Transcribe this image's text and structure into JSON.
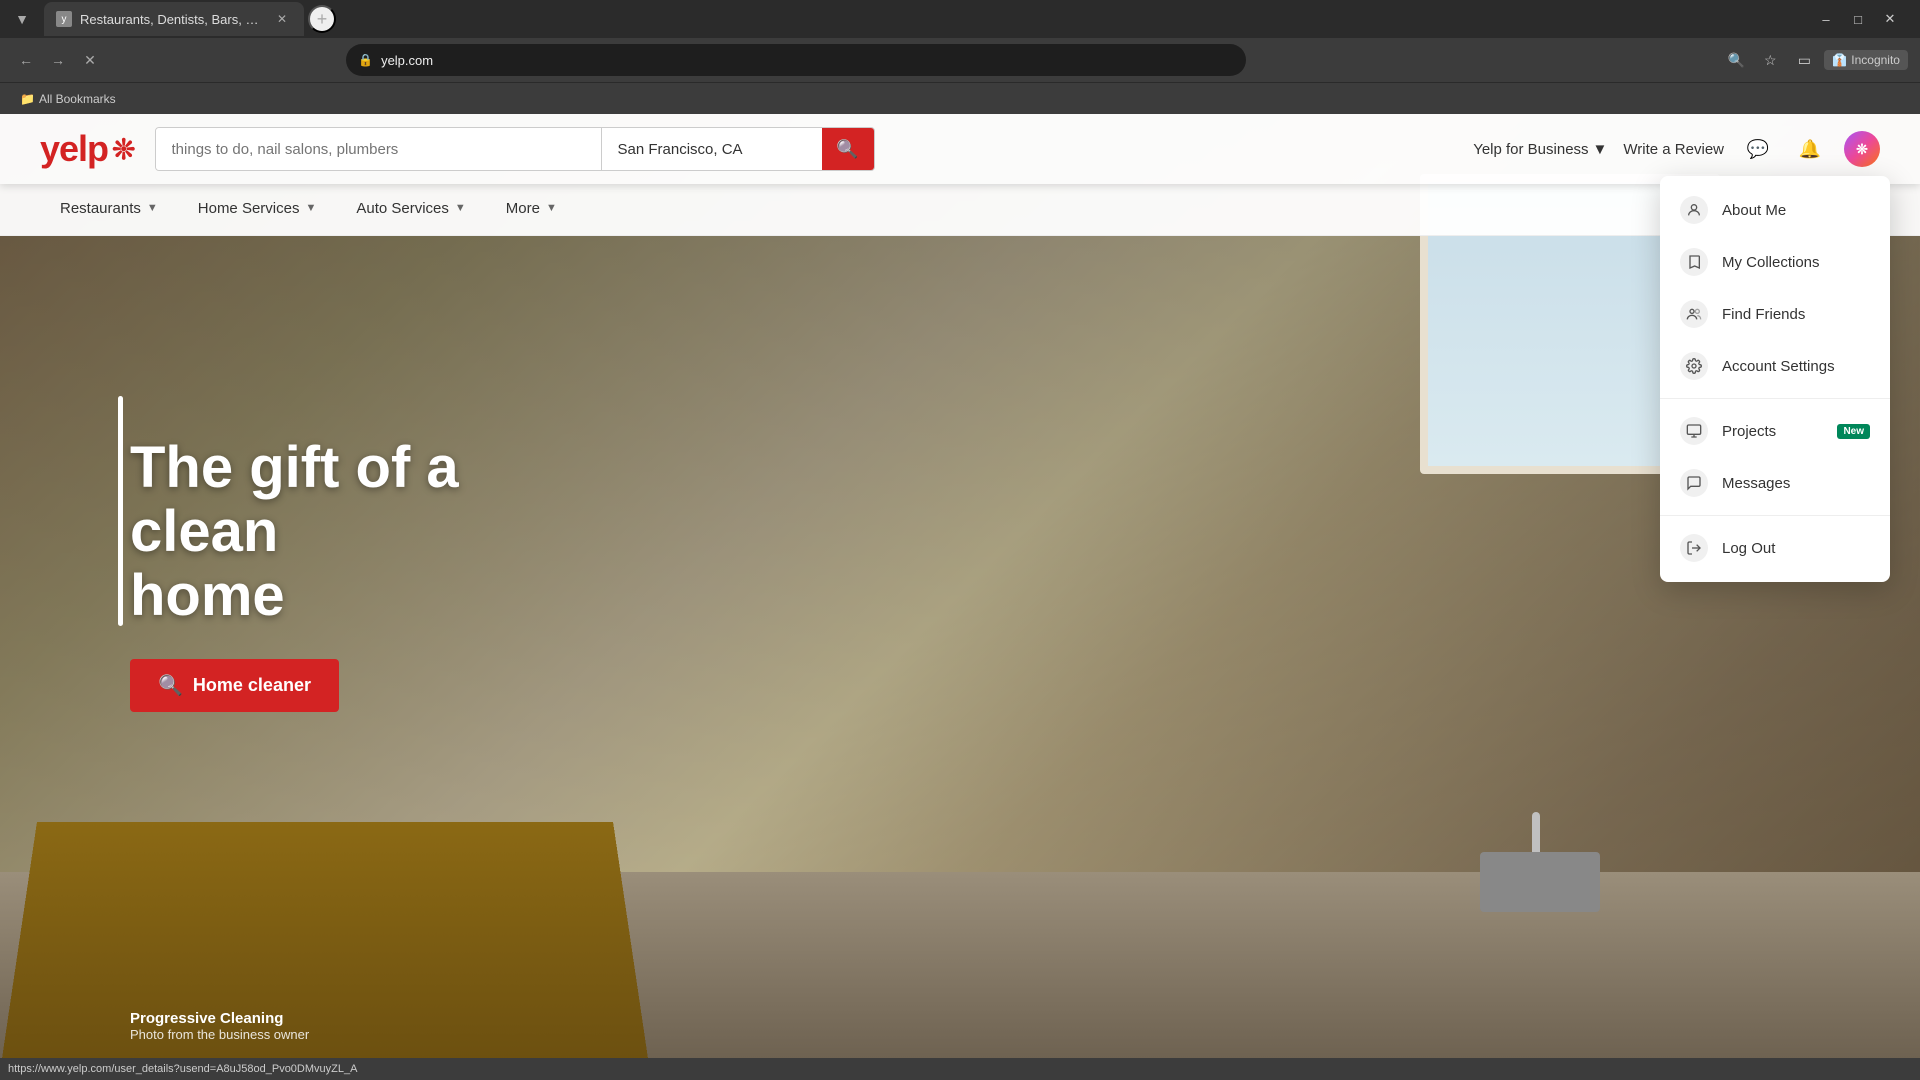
{
  "browser": {
    "tab_title": "Restaurants, Dentists, Bars, Bea",
    "url": "yelp.com",
    "incognito_label": "Incognito",
    "bookmarks_label": "All Bookmarks",
    "loading": true
  },
  "header": {
    "logo": "yelp",
    "search_placeholder": "things to do, nail salons, plumbers",
    "location_placeholder": "San Francisco, CA",
    "search_value": "",
    "location_value": "San Francisco, CA",
    "yelp_business_label": "Yelp for Business",
    "write_review_label": "Write a Review"
  },
  "nav": {
    "items": [
      {
        "label": "Restaurants",
        "id": "restaurants"
      },
      {
        "label": "Home Services",
        "id": "home-services"
      },
      {
        "label": "Auto Services",
        "id": "auto-services"
      },
      {
        "label": "More",
        "id": "more"
      }
    ]
  },
  "hero": {
    "title_line1": "The gift of a clean",
    "title_line2": "home",
    "cta_label": "Home cleaner",
    "photo_business": "Progressive Cleaning",
    "photo_credit": "Photo from the business owner"
  },
  "dropdown": {
    "items": [
      {
        "label": "About Me",
        "icon": "👤",
        "id": "about-me"
      },
      {
        "label": "My Collections",
        "icon": "🔖",
        "id": "my-collections"
      },
      {
        "label": "Find Friends",
        "icon": "👥",
        "id": "find-friends"
      },
      {
        "label": "Account Settings",
        "icon": "⚙️",
        "id": "account-settings"
      },
      {
        "label": "Projects",
        "icon": "🗂️",
        "id": "projects",
        "badge": "New"
      },
      {
        "label": "Messages",
        "icon": "💬",
        "id": "messages"
      },
      {
        "label": "Log Out",
        "icon": "🚪",
        "id": "log-out"
      }
    ]
  },
  "status_bar": {
    "url": "https://www.yelp.com/user_details?usend=A8uJ58od_Pvo0DMvuyZL_A"
  }
}
